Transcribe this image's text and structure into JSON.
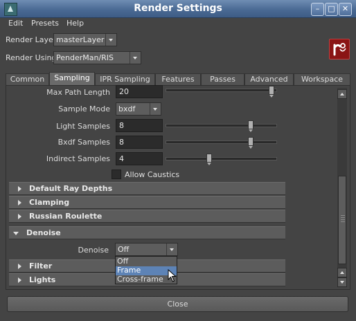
{
  "window": {
    "title": "Render Settings",
    "minimize_glyph": "–",
    "maximize_glyph": "□",
    "close_glyph": "✕"
  },
  "menu": [
    "Edit",
    "Presets",
    "Help"
  ],
  "render_layer": {
    "label": "Render Layer",
    "value": "masterLayer"
  },
  "render_using": {
    "label": "Render Using",
    "value": "PenderMan/RIS"
  },
  "tabs": [
    "Common",
    "Sampling",
    "IPR Sampling",
    "Features",
    "Passes",
    "Advanced",
    "Workspace"
  ],
  "active_tab": "Sampling",
  "fields": {
    "max_path_length": {
      "label": "Max Path Length",
      "value": "20"
    },
    "sample_mode": {
      "label": "Sample Mode",
      "value": "bxdf"
    },
    "light_samples": {
      "label": "Light Samples",
      "value": "8"
    },
    "bxdf_samples": {
      "label": "Bxdf Samples",
      "value": "8"
    },
    "indirect_samples": {
      "label": "Indirect Samples",
      "value": "4"
    },
    "allow_caustics": {
      "label": "Allow Caustics",
      "checked": false
    }
  },
  "sections": {
    "default_ray_depths": "Default Ray Depths",
    "clamping": "Clamping",
    "russian_roulette": "Russian Roulette",
    "denoise": "Denoise",
    "filter": "Filter",
    "lights": "Lights"
  },
  "denoise": {
    "label": "Denoise",
    "value": "Off",
    "options": [
      "Off",
      "Frame",
      "Cross-frame"
    ],
    "highlighted": "Frame"
  },
  "close_label": "Close",
  "colors": {
    "titlebar": "#4a6a94",
    "selection": "#5d83b6",
    "background": "#444444",
    "logo": "#8a1414"
  }
}
